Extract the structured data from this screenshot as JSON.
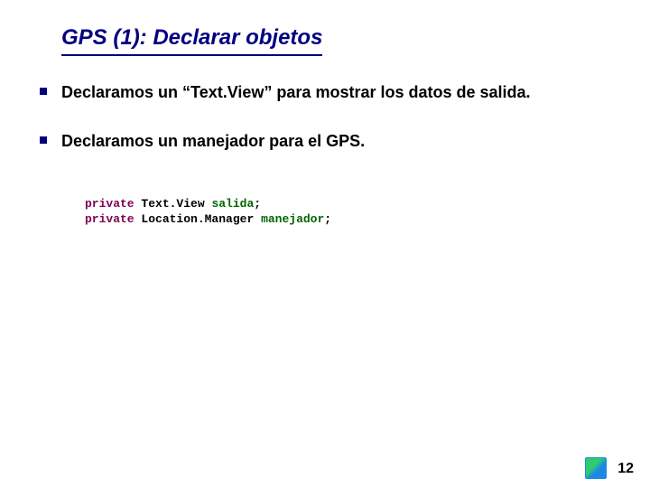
{
  "title": "GPS (1): Declarar objetos",
  "bullets": [
    "Declaramos un “Text.View” para mostrar los datos de salida.",
    "Declaramos un manejador para el GPS."
  ],
  "code": {
    "line1": {
      "kw": "private",
      "cls": "Text.View",
      "var": "salida",
      "end": ";"
    },
    "line2": {
      "kw": "private",
      "cls": "Location.Manager",
      "var": "manejador",
      "end": ";"
    }
  },
  "logo_text": "",
  "page_number": "12"
}
